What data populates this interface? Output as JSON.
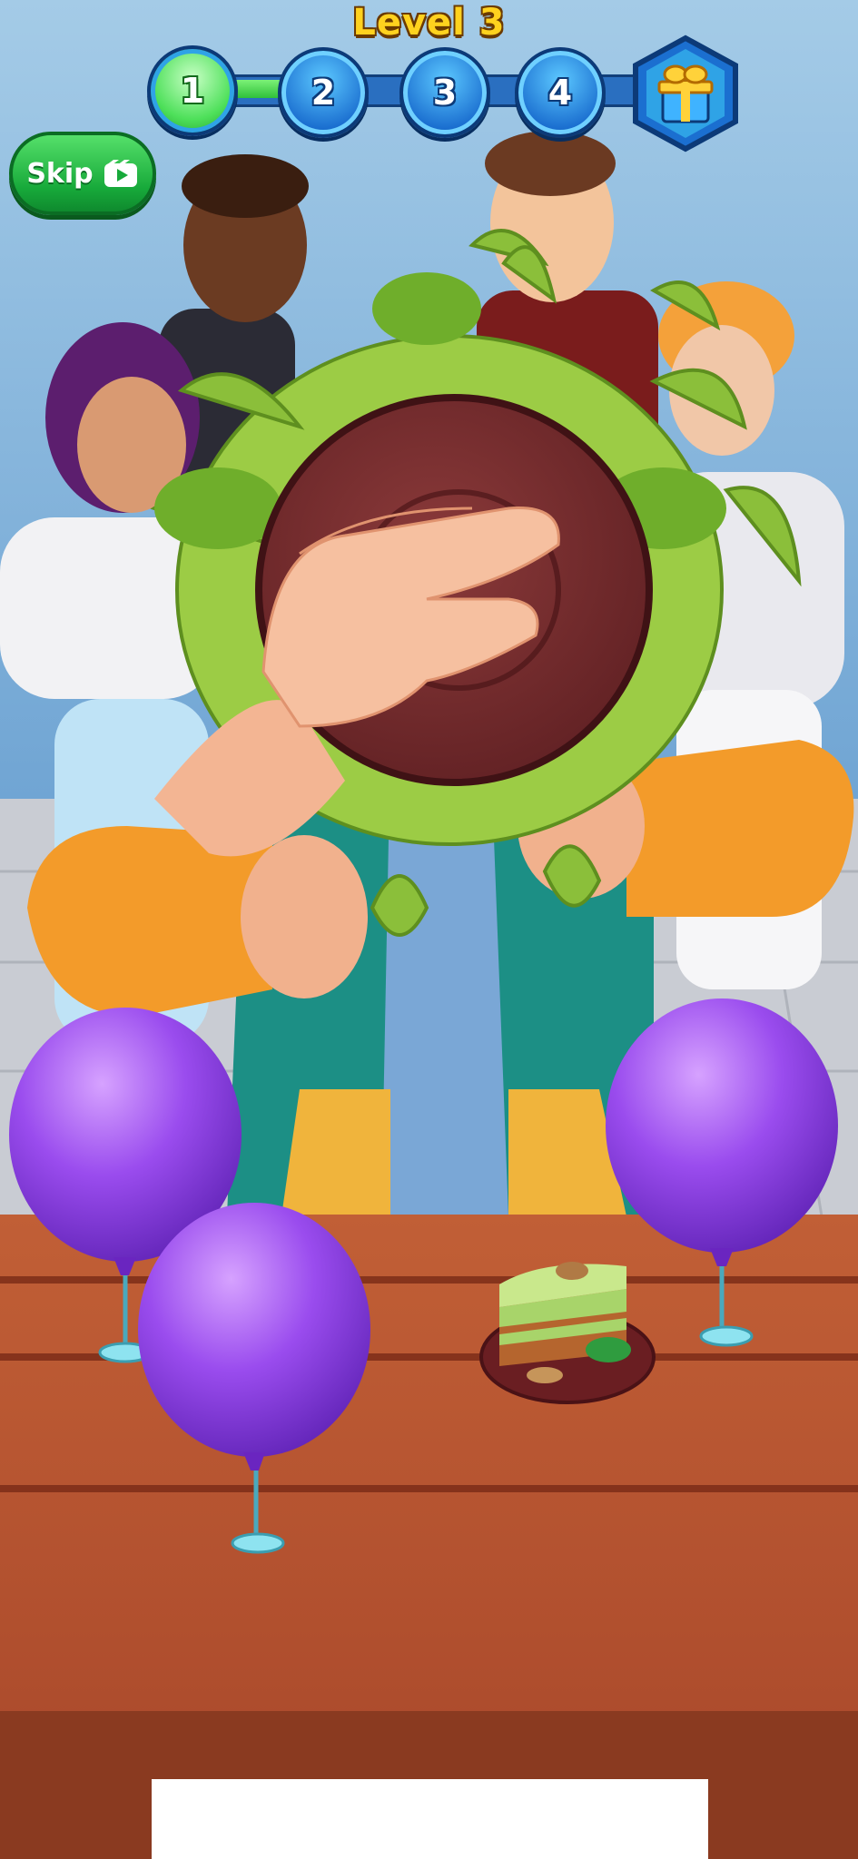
{
  "header": {
    "level_title": "Level 3"
  },
  "progress": {
    "steps": [
      "1",
      "2",
      "3",
      "4"
    ],
    "active_step": 1,
    "reward_icon": "gift-box-icon"
  },
  "skip_button": {
    "label": "Skip",
    "icon": "video-ad-icon"
  },
  "scene": {
    "description_icons": [
      "slime-splash",
      "hand",
      "purple-balloon",
      "cake-slice"
    ]
  },
  "colors": {
    "level_title": "#ffd21e",
    "skip_button": "#17a93a",
    "progress_active": "#4ee05a",
    "progress_node": "#1b6fd0",
    "balloon": "#8a3ee0",
    "table": "#b5532f"
  }
}
